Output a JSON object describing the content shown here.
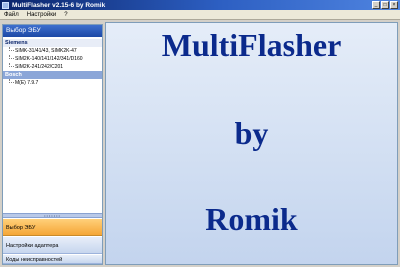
{
  "window": {
    "title": "MultiFlasher v2.15-6 by Romik"
  },
  "menu": [
    "Файл",
    "Настройки",
    "?"
  ],
  "sidebar": {
    "header": "Выбор ЭБУ",
    "groups": [
      {
        "label": "Siemens",
        "items": [
          "SIMK-31/41/43, SIMK2K-47",
          "SIM2K-140/141/142/341/D160",
          "SIM2K-241/242/C201"
        ]
      },
      {
        "label": "Bosch",
        "items": [
          "M(E) 7.9.7"
        ]
      }
    ],
    "splitter": "•••••••",
    "nav": [
      {
        "label": "Выбор ЭБУ",
        "active": true
      },
      {
        "label": "Настройки адаптера",
        "active": false
      },
      {
        "label": "Коды неисправностей",
        "active": false
      }
    ]
  },
  "main": {
    "lines": [
      "MultiFlasher",
      "by",
      "Romik"
    ]
  }
}
